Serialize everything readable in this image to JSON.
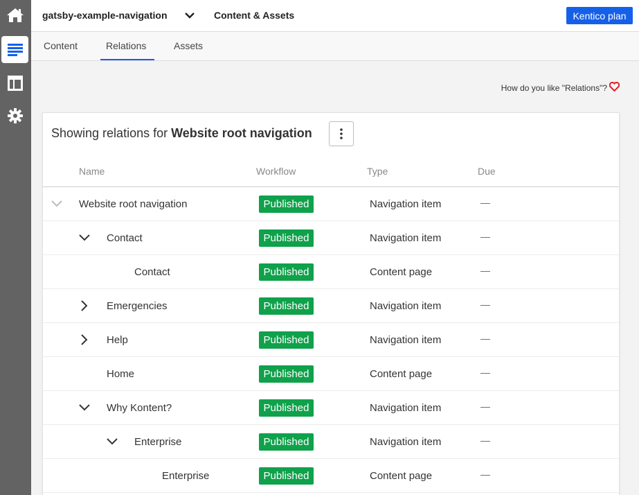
{
  "topbar": {
    "project_name": "gatsby-example-navigation",
    "section_name": "Content & Assets",
    "plan_button": "Kentico plan"
  },
  "tabs": [
    {
      "label": "Content"
    },
    {
      "label": "Relations"
    },
    {
      "label": "Assets"
    }
  ],
  "feedback": {
    "text": "How do you like \"Relations\"?"
  },
  "panel": {
    "heading_prefix": "Showing relations for",
    "heading_item": "Website root navigation",
    "columns": {
      "name": "Name",
      "workflow": "Workflow",
      "type": "Type",
      "due": "Due"
    }
  },
  "rows": [
    {
      "name": "Website root navigation",
      "workflow": "Published",
      "type": "Navigation item",
      "due": "—",
      "toggle": "collapse-disabled",
      "depth": 0
    },
    {
      "name": "Contact",
      "workflow": "Published",
      "type": "Navigation item",
      "due": "—",
      "toggle": "collapse",
      "depth": 1
    },
    {
      "name": "Contact",
      "workflow": "Published",
      "type": "Content page",
      "due": "—",
      "toggle": "none",
      "depth": 2
    },
    {
      "name": "Emergencies",
      "workflow": "Published",
      "type": "Navigation item",
      "due": "—",
      "toggle": "expand",
      "depth": 1
    },
    {
      "name": "Help",
      "workflow": "Published",
      "type": "Navigation item",
      "due": "—",
      "toggle": "expand",
      "depth": 1
    },
    {
      "name": "Home",
      "workflow": "Published",
      "type": "Content page",
      "due": "—",
      "toggle": "none",
      "depth": 1
    },
    {
      "name": "Why Kontent?",
      "workflow": "Published",
      "type": "Navigation item",
      "due": "—",
      "toggle": "collapse",
      "depth": 1
    },
    {
      "name": "Enterprise",
      "workflow": "Published",
      "type": "Navigation item",
      "due": "—",
      "toggle": "collapse",
      "depth": 2
    },
    {
      "name": "Enterprise",
      "workflow": "Published",
      "type": "Content page",
      "due": "—",
      "toggle": "none",
      "depth": 3
    }
  ],
  "colors": {
    "accent": "#1560e9",
    "published": "#10a14b",
    "rail": "#636363"
  }
}
